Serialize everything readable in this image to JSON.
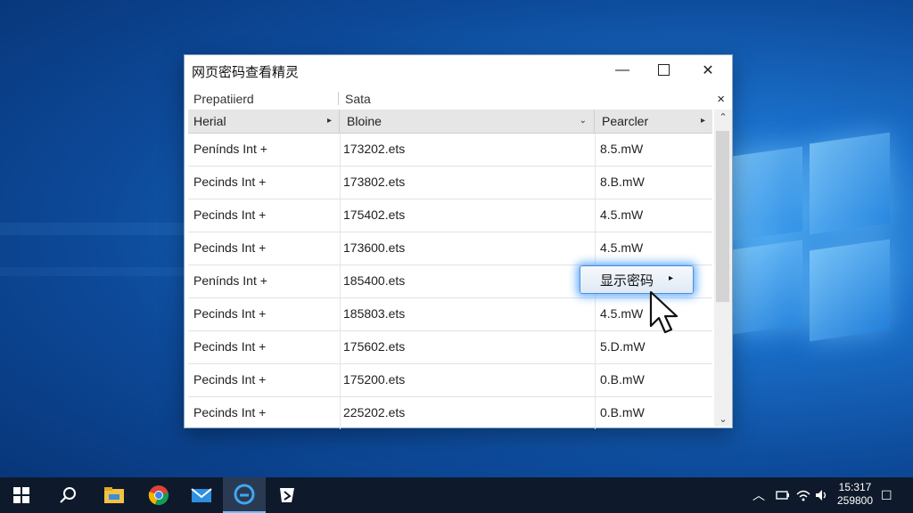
{
  "window": {
    "title": "网页密码查看精灵",
    "minimize_glyph": "—",
    "close_glyph": "✕"
  },
  "group_header": {
    "col1": "Prepatiierd",
    "col2": "Sata",
    "close_glyph": "×"
  },
  "table": {
    "headers": [
      "Herial",
      "Bloine",
      "Pearcler"
    ],
    "header_arrows": [
      "▸",
      "⌄",
      "▸"
    ],
    "rows": [
      {
        "name": "Penínds Int +",
        "data": "173202.ets",
        "value": "8.5.mW"
      },
      {
        "name": "Pecinds Int +",
        "data": "173802.ets",
        "value": "8.B.mW"
      },
      {
        "name": "Pecinds Int +",
        "data": "175402.ets",
        "value": "4.5.mW"
      },
      {
        "name": "Pecinds Int +",
        "data": "173600.ets",
        "value": "4.5.mW"
      },
      {
        "name": "Penínds Int +",
        "data": "185400.ets",
        "value": ""
      },
      {
        "name": "Pecinds Int +",
        "data": "185803.ets",
        "value": "4.5.mW"
      },
      {
        "name": "Pecinds Int +",
        "data": "175602.ets",
        "value": "5.D.mW"
      },
      {
        "name": "Pecinds Int +",
        "data": "175200.ets",
        "value": "0.B.mW"
      },
      {
        "name": "Pecinds Int +",
        "data": "225202.ets",
        "value": "0.B.mW"
      }
    ]
  },
  "reveal_button": {
    "label": "显示密码",
    "arrow": "▸"
  },
  "scrollbar": {
    "up": "⌃",
    "down": "⌄"
  },
  "taskbar": {
    "icons": [
      "windows-start-icon",
      "search-icon",
      "file-explorer-icon",
      "chrome-icon",
      "mail-icon",
      "edge-icon",
      "app-icon"
    ],
    "clock_time": "15:317",
    "clock_date": "259800",
    "tray_glyphs": {
      "chevron": "︿",
      "notification": "☐"
    }
  },
  "colors": {
    "accent": "#4f8fd8",
    "taskbar": "#0e1a2b",
    "desktop": "#1a6fc9"
  }
}
